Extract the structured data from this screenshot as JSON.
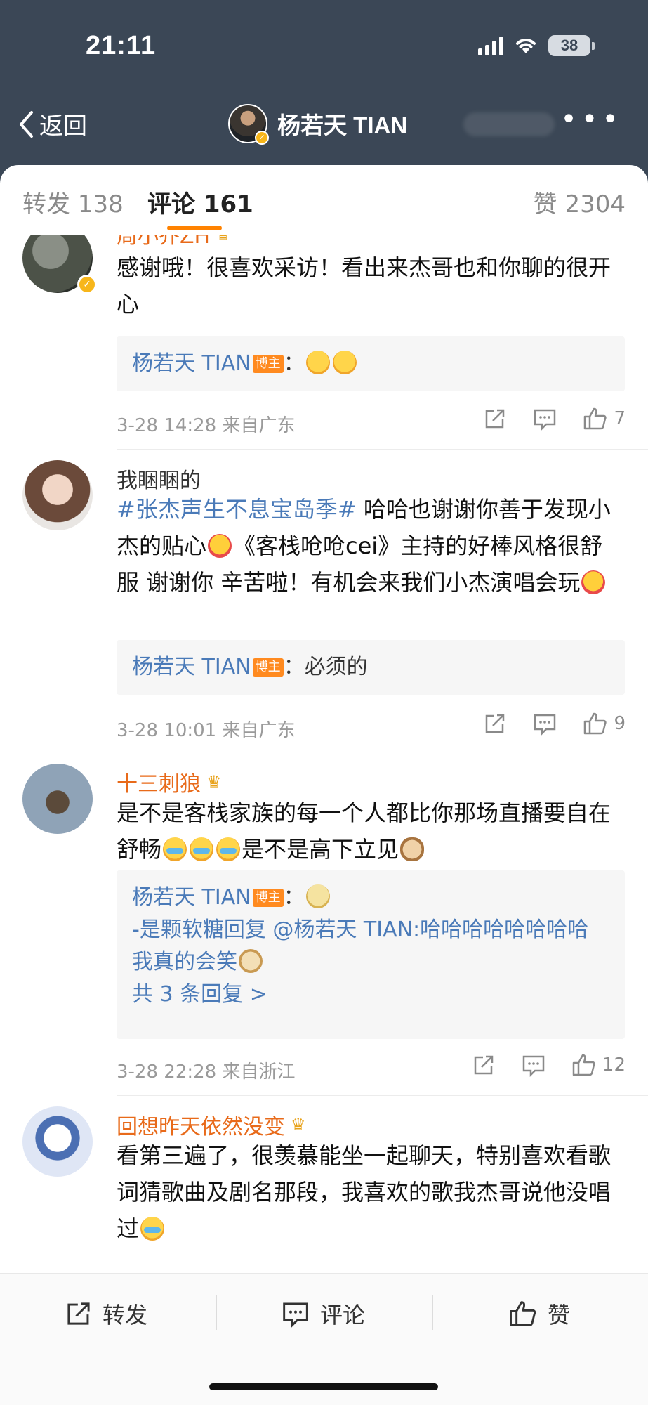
{
  "status_bar": {
    "time": "21:11",
    "battery": "38"
  },
  "nav": {
    "back_label": "返回",
    "title": "杨若天 TIAN"
  },
  "tabs": {
    "repost": "转发 138",
    "comment": "评论 161",
    "like": "赞 2304"
  },
  "comments": [
    {
      "name": "周小乔ZH",
      "text": "感谢哦！很喜欢采访！看出来杰哥也和你聊的很开心",
      "reply_author": "杨若天 TIAN",
      "author_badge": "博主",
      "reply_text": "：",
      "time": "3-28 14:28 来自广东",
      "likes": "7"
    },
    {
      "name": "我睏睏的",
      "hashtag": "#张杰声生不息宝岛季#",
      "text_a": " 哈哈也谢谢你善于发现小杰的贴心",
      "text_b": "《客栈呛呛cei》主持的好棒风格很舒服 谢谢你 辛苦啦！有机会来我们小杰演唱会玩",
      "reply_author": "杨若天 TIAN",
      "author_badge": "博主",
      "reply_text": "：必须的",
      "time": "3-28 10:01 来自广东",
      "likes": "9"
    },
    {
      "name": "十三刺狼",
      "text_a": "是不是客栈家族的每一个人都比你那场直播要自在舒畅",
      "text_b": "是不是高下立见",
      "reply_author": "杨若天 TIAN",
      "author_badge": "博主",
      "reply_text": "：",
      "sub_reply": "-是颗软糖回复 @杨若天 TIAN:哈哈哈哈哈哈哈哈我真的会笑",
      "more_replies": "共 3 条回复 >",
      "time": "3-28 22:28 来自浙江",
      "likes": "12"
    },
    {
      "name": "回想昨天依然没变",
      "text": "看第三遍了，很羡慕能坐一起聊天，特别喜欢看歌词猜歌曲及剧名那段，我喜欢的歌我杰哥说他没唱过"
    }
  ],
  "bottom_bar": {
    "repost": "转发",
    "comment": "评论",
    "like": "赞"
  },
  "colors": {
    "header_bg": "#3b4756",
    "accent": "#ff8200",
    "link": "#4a7ab8",
    "username": "#e86a1a"
  }
}
